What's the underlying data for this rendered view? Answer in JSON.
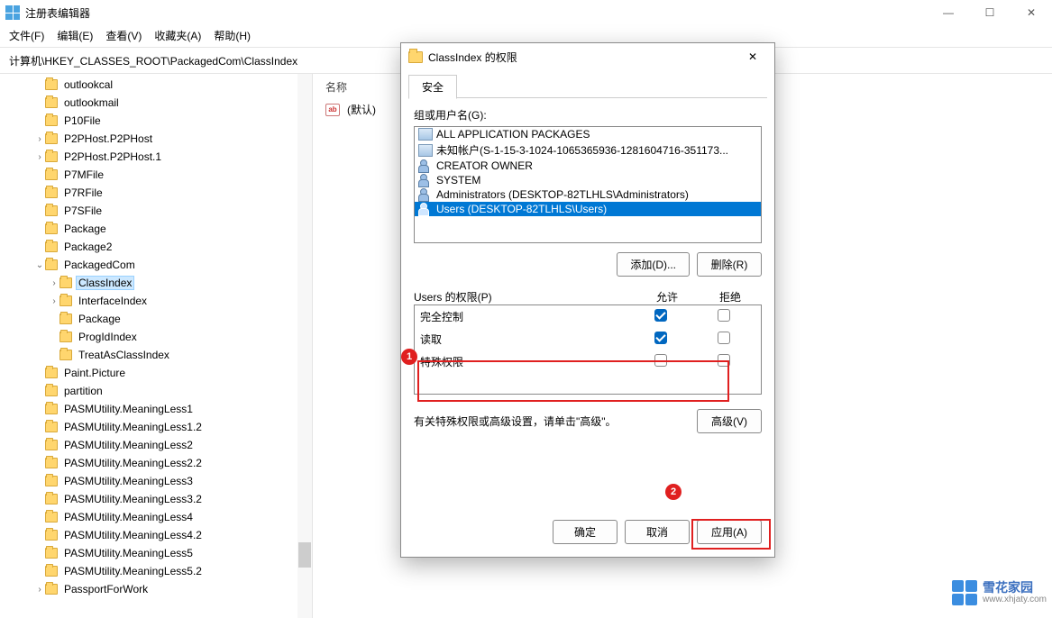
{
  "window": {
    "title": "注册表编辑器",
    "minimize": "—",
    "maximize": "☐",
    "close": "✕"
  },
  "menu": {
    "file": "文件(F)",
    "edit": "编辑(E)",
    "view": "查看(V)",
    "fav": "收藏夹(A)",
    "help": "帮助(H)"
  },
  "address": "计算机\\HKEY_CLASSES_ROOT\\PackagedCom\\ClassIndex",
  "list": {
    "header_name": "名称",
    "default_value": "(默认)"
  },
  "tree": [
    {
      "d": 2,
      "chev": "",
      "label": "outlookcal"
    },
    {
      "d": 2,
      "chev": "",
      "label": "outlookmail"
    },
    {
      "d": 2,
      "chev": "",
      "label": "P10File"
    },
    {
      "d": 2,
      "chev": ">",
      "label": "P2PHost.P2PHost"
    },
    {
      "d": 2,
      "chev": ">",
      "label": "P2PHost.P2PHost.1"
    },
    {
      "d": 2,
      "chev": "",
      "label": "P7MFile"
    },
    {
      "d": 2,
      "chev": "",
      "label": "P7RFile"
    },
    {
      "d": 2,
      "chev": "",
      "label": "P7SFile"
    },
    {
      "d": 2,
      "chev": "",
      "label": "Package"
    },
    {
      "d": 2,
      "chev": "",
      "label": "Package2"
    },
    {
      "d": 2,
      "chev": "v",
      "label": "PackagedCom"
    },
    {
      "d": 3,
      "chev": ">",
      "label": "ClassIndex",
      "sel": true
    },
    {
      "d": 3,
      "chev": ">",
      "label": "InterfaceIndex"
    },
    {
      "d": 3,
      "chev": "",
      "label": "Package"
    },
    {
      "d": 3,
      "chev": "",
      "label": "ProgIdIndex"
    },
    {
      "d": 3,
      "chev": "",
      "label": "TreatAsClassIndex"
    },
    {
      "d": 2,
      "chev": "",
      "label": "Paint.Picture"
    },
    {
      "d": 2,
      "chev": "",
      "label": "partition"
    },
    {
      "d": 2,
      "chev": "",
      "label": "PASMUtility.MeaningLess1"
    },
    {
      "d": 2,
      "chev": "",
      "label": "PASMUtility.MeaningLess1.2"
    },
    {
      "d": 2,
      "chev": "",
      "label": "PASMUtility.MeaningLess2"
    },
    {
      "d": 2,
      "chev": "",
      "label": "PASMUtility.MeaningLess2.2"
    },
    {
      "d": 2,
      "chev": "",
      "label": "PASMUtility.MeaningLess3"
    },
    {
      "d": 2,
      "chev": "",
      "label": "PASMUtility.MeaningLess3.2"
    },
    {
      "d": 2,
      "chev": "",
      "label": "PASMUtility.MeaningLess4"
    },
    {
      "d": 2,
      "chev": "",
      "label": "PASMUtility.MeaningLess4.2"
    },
    {
      "d": 2,
      "chev": "",
      "label": "PASMUtility.MeaningLess5"
    },
    {
      "d": 2,
      "chev": "",
      "label": "PASMUtility.MeaningLess5.2"
    },
    {
      "d": 2,
      "chev": ">",
      "label": "PassportForWork"
    }
  ],
  "dialog": {
    "title": "ClassIndex 的权限",
    "close": "✕",
    "tab": "安全",
    "group_label": "组或用户名(G):",
    "users": [
      {
        "icon": "proc",
        "label": "ALL APPLICATION PACKAGES"
      },
      {
        "icon": "proc",
        "label": "未知帐户(S-1-15-3-1024-1065365936-1281604716-351173..."
      },
      {
        "icon": "user",
        "label": "CREATOR OWNER"
      },
      {
        "icon": "user",
        "label": "SYSTEM"
      },
      {
        "icon": "user",
        "label": "Administrators (DESKTOP-82TLHLS\\Administrators)"
      },
      {
        "icon": "user",
        "label": "Users (DESKTOP-82TLHLS\\Users)",
        "sel": true
      }
    ],
    "add_btn": "添加(D)...",
    "remove_btn": "删除(R)",
    "perm_label": "Users 的权限(P)",
    "col_allow": "允许",
    "col_deny": "拒绝",
    "perms": [
      {
        "name": "完全控制",
        "allow": true,
        "deny": false
      },
      {
        "name": "读取",
        "allow": true,
        "deny": false
      },
      {
        "name": "特殊权限",
        "allow": false,
        "deny": false
      }
    ],
    "note": "有关特殊权限或高级设置，请单击\"高级\"。",
    "adv_btn": "高级(V)",
    "ok": "确定",
    "cancel": "取消",
    "apply": "应用(A)"
  },
  "annot": {
    "n1": "1",
    "n2": "2"
  },
  "watermark": {
    "name": "雪花家园",
    "url": "www.xhjaty.com"
  }
}
